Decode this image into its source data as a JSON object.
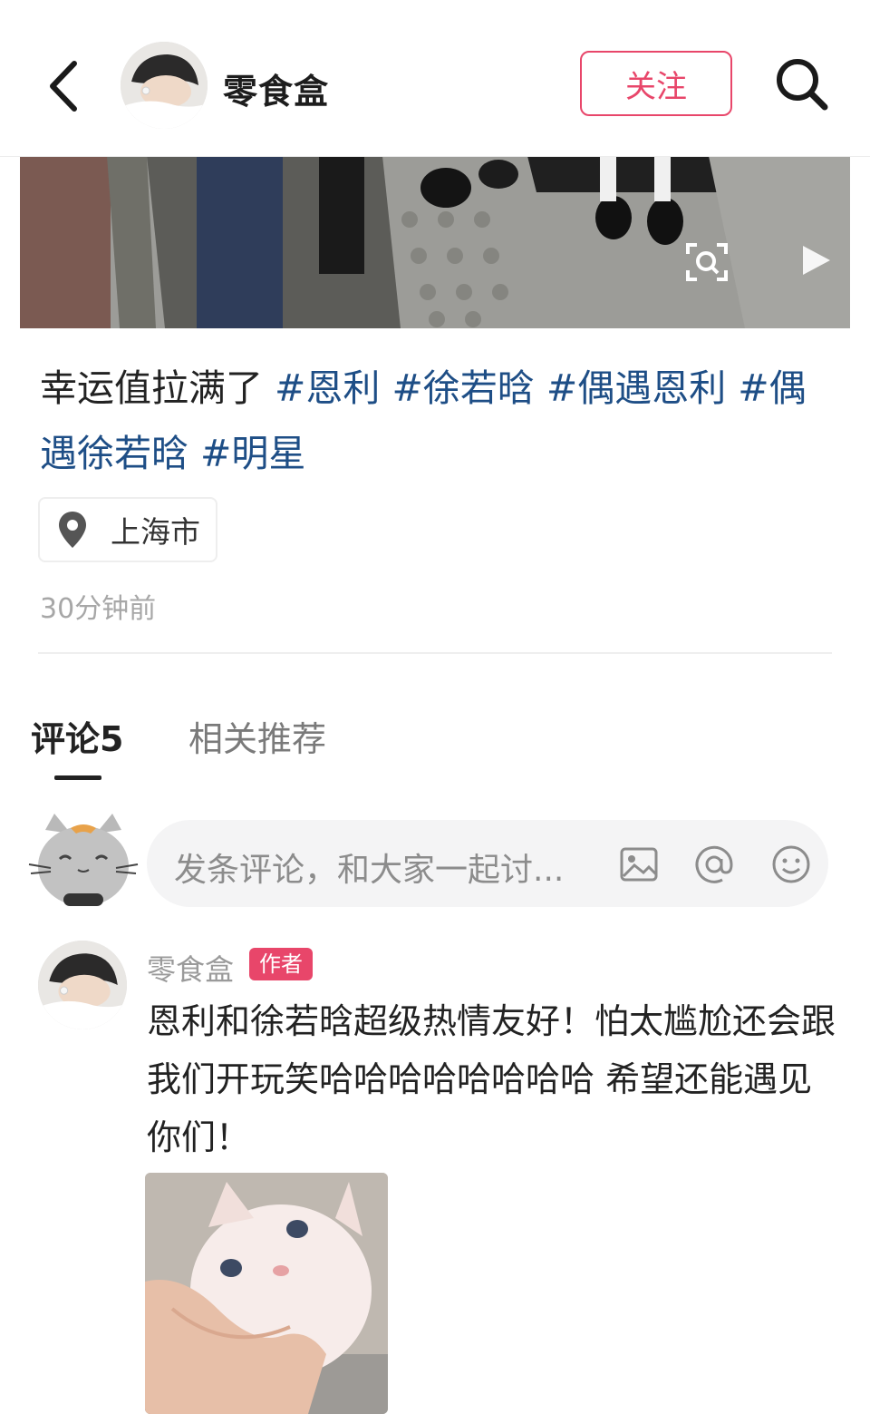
{
  "header": {
    "author_name": "零食盒",
    "follow_label": "关注"
  },
  "post": {
    "caption_plain": "幸运值拉满了",
    "tags": [
      "#恩利",
      "#徐若晗",
      "#偶遇恩利",
      "#偶遇徐若晗",
      "#明星"
    ],
    "location": "上海市",
    "time": "30分钟前"
  },
  "tabs": {
    "comments_label": "评论",
    "comments_count": "5",
    "related_label": "相关推荐"
  },
  "comment_input": {
    "placeholder": "发条评论，和大家一起讨..."
  },
  "comment": {
    "author": "零食盒",
    "badge": "作者",
    "text": "恩利和徐若晗超级热情友好！怕太尴尬还会跟我们开玩笑哈哈哈哈哈哈哈哈 希望还能遇见你们！"
  },
  "colors": {
    "accent": "#e8466a",
    "tag": "#1e4e86",
    "muted": "#a7a7a7"
  },
  "icons": [
    "back-arrow-icon",
    "search-icon",
    "scan-icon",
    "play-icon",
    "location-pin-icon",
    "image-icon",
    "at-icon",
    "emoji-icon"
  ]
}
